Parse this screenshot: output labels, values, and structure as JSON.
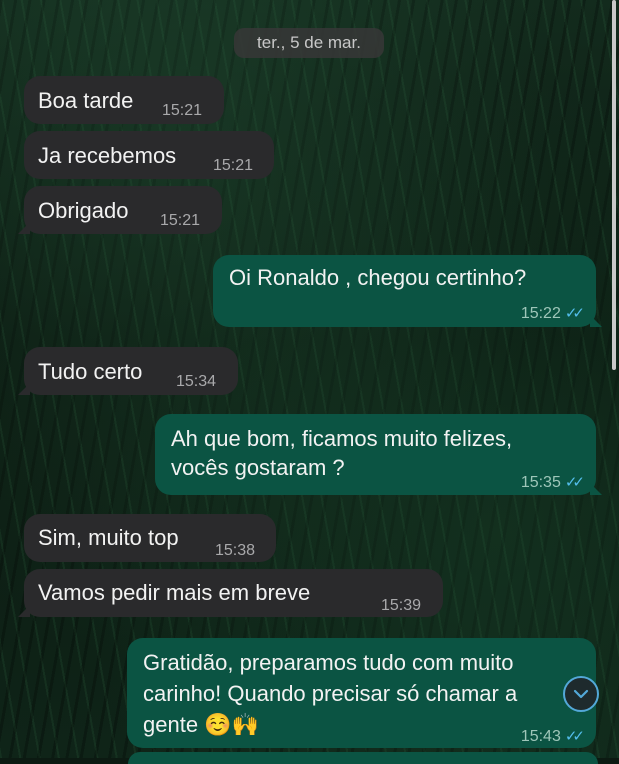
{
  "chat": {
    "date_label": "ter., 5 de mar.",
    "messages": [
      {
        "dir": "in",
        "text": "Boa tarde",
        "time": "15:21"
      },
      {
        "dir": "in",
        "text": "Ja recebemos",
        "time": "15:21"
      },
      {
        "dir": "in",
        "text": "Obrigado",
        "time": "15:21"
      },
      {
        "dir": "out",
        "text": "Oi Ronaldo , chegou certinho?",
        "time": "15:22",
        "ticks": "✓✓"
      },
      {
        "dir": "in",
        "text": "Tudo certo",
        "time": "15:34"
      },
      {
        "dir": "out",
        "text": "Ah que bom, ficamos muito felizes,\nvocês gostaram ?",
        "time": "15:35",
        "ticks": "✓✓"
      },
      {
        "dir": "in",
        "text": "Sim, muito top",
        "time": "15:38"
      },
      {
        "dir": "in",
        "text": "Vamos pedir mais em breve",
        "time": "15:39"
      },
      {
        "dir": "out",
        "text": "Gratidão, preparamos tudo com muito\ncarinho! Quando precisar só chamar a\ngente ☺️🙌",
        "time": "15:43",
        "ticks": "✓✓"
      }
    ]
  },
  "colors": {
    "incoming_bubble": "#2a2a2c",
    "outgoing_bubble": "#0b5443",
    "read_ticks": "#53bdeb"
  },
  "icons": {
    "scroll_down": "chevron-down-icon"
  }
}
